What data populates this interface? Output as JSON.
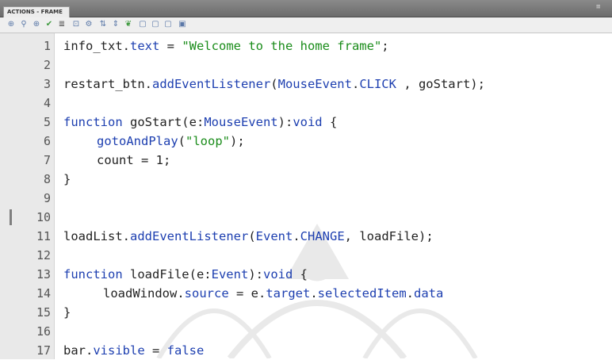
{
  "panel": {
    "tab_label": "ACTIONS - FRAME",
    "toolbar_icons": [
      "add-statement-icon",
      "find-icon",
      "target-icon",
      "check-syntax-icon",
      "auto-format-icon",
      "code-hint-icon",
      "debug-icon",
      "collapse-icon",
      "expand-icon",
      "apply-comment-icon",
      "block-comment-icon",
      "line-comment-icon",
      "remove-comment-icon",
      "toggle-toolbox-icon"
    ]
  },
  "code_lines": [
    {
      "n": "1",
      "text": "info_txt.text = \"Welcome to the home frame\";"
    },
    {
      "n": "2",
      "text": ""
    },
    {
      "n": "3",
      "text": "restart_btn.addEventListener(MouseEvent.CLICK , goStart);"
    },
    {
      "n": "4",
      "text": ""
    },
    {
      "n": "5",
      "text": "function goStart(e:MouseEvent):void {"
    },
    {
      "n": "6",
      "text": "gotoAndPlay(\"loop\");"
    },
    {
      "n": "7",
      "text": "count = 1;"
    },
    {
      "n": "8",
      "text": "}"
    },
    {
      "n": "9",
      "text": ""
    },
    {
      "n": "10",
      "text": ""
    },
    {
      "n": "11",
      "text": "loadList.addEventListener(Event.CHANGE, loadFile);"
    },
    {
      "n": "12",
      "text": ""
    },
    {
      "n": "13",
      "text": "function loadFile(e:Event):void {"
    },
    {
      "n": "14",
      "text": "loadWindow.source = e.target.selectedItem.data"
    },
    {
      "n": "15",
      "text": "}"
    },
    {
      "n": "16",
      "text": ""
    },
    {
      "n": "17",
      "text": "bar.visible = false"
    }
  ]
}
